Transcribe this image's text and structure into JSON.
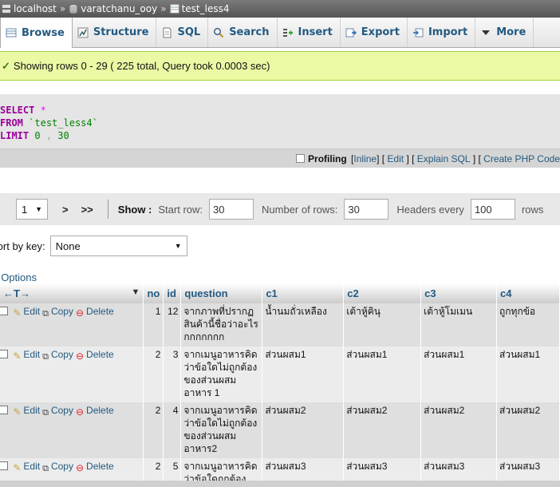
{
  "breadcrumb": {
    "server": "localhost",
    "database": "varatchanu_ooy",
    "table": "test_less4",
    "separator": "»"
  },
  "tabs": [
    {
      "label": "Browse",
      "icon": "browse-icon",
      "active": true
    },
    {
      "label": "Structure",
      "icon": "structure-icon"
    },
    {
      "label": "SQL",
      "icon": "sql-icon"
    },
    {
      "label": "Search",
      "icon": "search-icon"
    },
    {
      "label": "Insert",
      "icon": "insert-icon"
    },
    {
      "label": "Export",
      "icon": "export-icon"
    },
    {
      "label": "Import",
      "icon": "import-icon"
    },
    {
      "label": "More",
      "icon": "chevron-down-icon"
    }
  ],
  "message": {
    "text": "Showing rows 0 - 29 ( 225 total, Query took 0.0003 sec)"
  },
  "sql": {
    "select": "SELECT",
    "star": "*",
    "from": "FROM",
    "table": "`test_less4`",
    "limit": "LIMIT",
    "offset": "0",
    "comma": ",",
    "count": "30"
  },
  "sql_bar": {
    "profiling": "Profiling",
    "inline": "Inline",
    "edit": "Edit",
    "explain": "Explain SQL",
    "create_php": "Create PHP Code"
  },
  "nav": {
    "page": "1",
    "next": ">",
    "last": ">>",
    "show_label": "Show :",
    "start_row_label": "Start row:",
    "start_row": "30",
    "num_rows_label": "Number of rows:",
    "num_rows": "30",
    "headers_label": "Headers every",
    "headers": "100",
    "rows_label": "rows"
  },
  "sort": {
    "label": "Sort by key:",
    "value": "None"
  },
  "options_label": "+ Options",
  "columns": [
    "no",
    "id",
    "question",
    "c1",
    "c2",
    "c3",
    "c4"
  ],
  "actions": {
    "edit": "Edit",
    "copy": "Copy",
    "delete": "Delete"
  },
  "rows": [
    {
      "no": "1",
      "id": "12",
      "question": "จากภาพที่ปรากฏสินค้านี้ชื่อว่าอะไรกกกกกกก",
      "c1": "น้ำนมถั่วเหลือง",
      "c2": "เต้าหู้คินุ",
      "c3": "เต้าหู้โมเมน",
      "c4": "ถูกทุกข้อ"
    },
    {
      "no": "2",
      "id": "3",
      "question": "จากเมนูอาหารคิดว่าข้อใดไม่ถูกต้องของส่วนผสมอาหาร 1",
      "c1": "ส่วนผสม1",
      "c2": "ส่วนผสม1",
      "c3": "ส่วนผสม1",
      "c4": "ส่วนผสม1"
    },
    {
      "no": "2",
      "id": "4",
      "question": "จากเมนูอาหารคิดว่าข้อใดไม่ถูกต้องของส่วนผสมอาหาร2",
      "c1": "ส่วนผสม2",
      "c2": "ส่วนผสม2",
      "c3": "ส่วนผสม2",
      "c4": "ส่วนผสม2"
    },
    {
      "no": "2",
      "id": "5",
      "question": "จากเมนูอาหารคิดว่าข้อใดถูกต้อง",
      "c1": "ส่วนผสม3",
      "c2": "ส่วนผสม3",
      "c3": "ส่วนผสม3",
      "c4": "ส่วนผสม3"
    }
  ],
  "colors": {
    "accent": "#235a81",
    "success_bg": "#ebf8a4",
    "keyword": "#990099",
    "string": "#008000"
  }
}
